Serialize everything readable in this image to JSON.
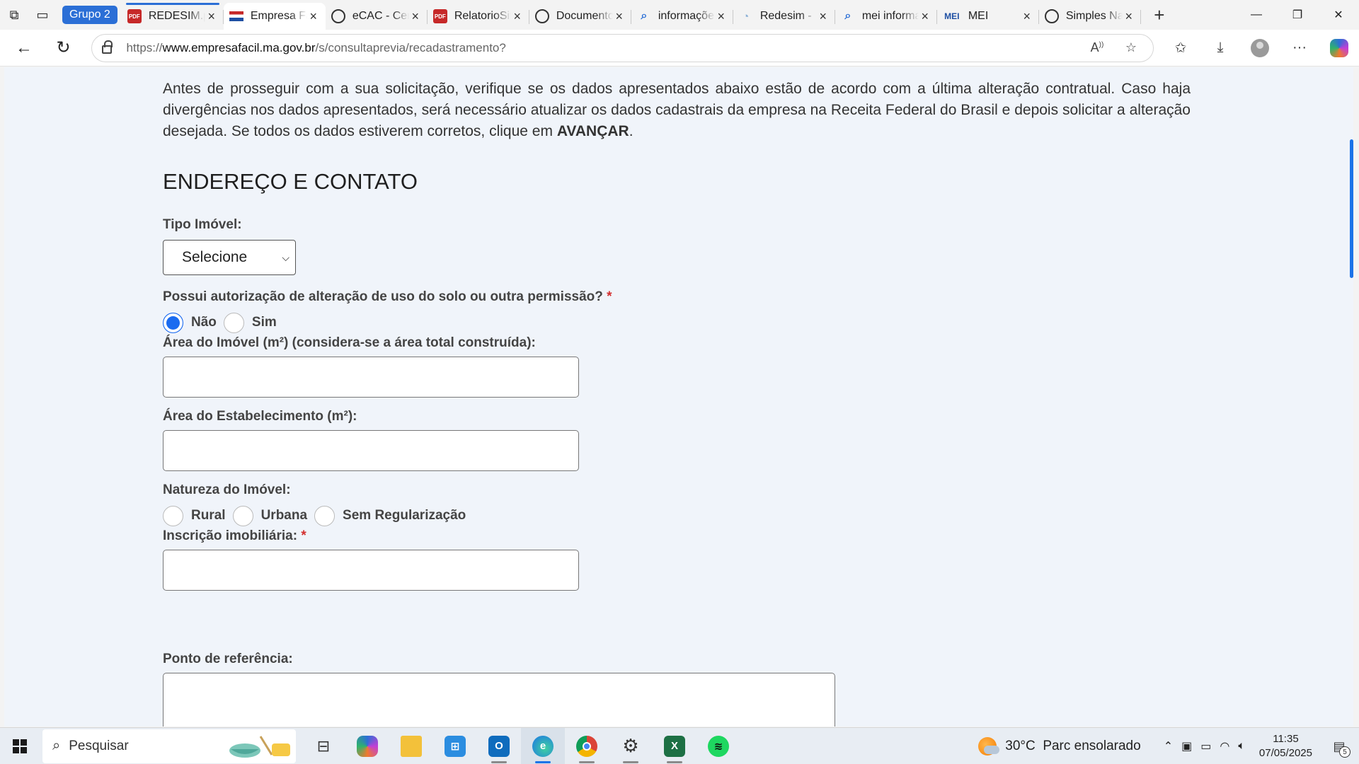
{
  "browser": {
    "tab_group": "Grupo 2",
    "tabs": [
      {
        "title": "REDESIM.pdf",
        "icon": "pdf-icon",
        "active": false,
        "grouped": true
      },
      {
        "title": "Empresa Fácil",
        "icon": "flag-icon",
        "active": true,
        "grouped": false
      },
      {
        "title": "eCAC - Centro Virtual",
        "icon": "globe-icon",
        "active": false,
        "grouped": false
      },
      {
        "title": "RelatorioSituacao.pdf",
        "icon": "pdf-icon",
        "active": false,
        "grouped": false
      },
      {
        "title": "Documentos",
        "icon": "globe-icon",
        "active": false,
        "grouped": false
      },
      {
        "title": "informações",
        "icon": "search-icon",
        "active": false,
        "grouped": false
      },
      {
        "title": "Redesim - ",
        "icon": "wifi-icon",
        "active": false,
        "grouped": false
      },
      {
        "title": "mei informações",
        "icon": "search-icon",
        "active": false,
        "grouped": false
      },
      {
        "title": "MEI",
        "icon": "mei-icon",
        "active": false,
        "grouped": false
      },
      {
        "title": "Simples Nacional",
        "icon": "globe-icon",
        "active": false,
        "grouped": false
      }
    ],
    "url_prefix": "https://",
    "url_host": "www.empresafacil.ma.gov.br",
    "url_path": "/s/consultaprevia/recadastramento?"
  },
  "page": {
    "intro_text": "Antes de prosseguir com a sua solicitação, verifique se os dados apresentados abaixo estão de acordo com a última alteração contratual. Caso haja divergências nos dados apresentados, será necessário atualizar os dados cadastrais da empresa na Receita Federal do Brasil e depois solicitar a alteração desejada. Se todos os dados estiverem corretos, clique em ",
    "intro_emphasis": "AVANÇAR",
    "intro_end": ".",
    "section_title": "ENDEREÇO E CONTATO",
    "tipo_imovel": {
      "label": "Tipo Imóvel:",
      "selected": "Selecione"
    },
    "autorizacao": {
      "label": "Possui autorização de alteração de uso do solo ou outra permissão?",
      "required_mark": "*",
      "options": [
        {
          "label": "Não",
          "checked": true
        },
        {
          "label": "Sim",
          "checked": false
        }
      ]
    },
    "area_imovel": {
      "label": "Área do Imóvel (m²) (considera-se a área total construída):",
      "value": ""
    },
    "area_estabelecimento": {
      "label": "Área do Estabelecimento (m²):",
      "value": ""
    },
    "natureza": {
      "label": "Natureza do Imóvel:",
      "options": [
        {
          "label": "Rural",
          "checked": false
        },
        {
          "label": "Urbana",
          "checked": false
        },
        {
          "label": "Sem Regularização",
          "checked": false
        }
      ]
    },
    "inscricao": {
      "label": "Inscrição imobiliária:",
      "required_mark": "*",
      "value": ""
    },
    "ponto_referencia": {
      "label": "Ponto de referência:",
      "value": ""
    }
  },
  "taskbar": {
    "search_placeholder": "Pesquisar",
    "weather": {
      "temp": "30°C",
      "desc": "Parc ensolarado"
    },
    "time": "11:35",
    "date": "07/05/2025",
    "notifications": "5"
  },
  "colors": {
    "accent": "#1b6bf0",
    "required": "#d32f2f",
    "page_bg": "#f0f4fa"
  }
}
